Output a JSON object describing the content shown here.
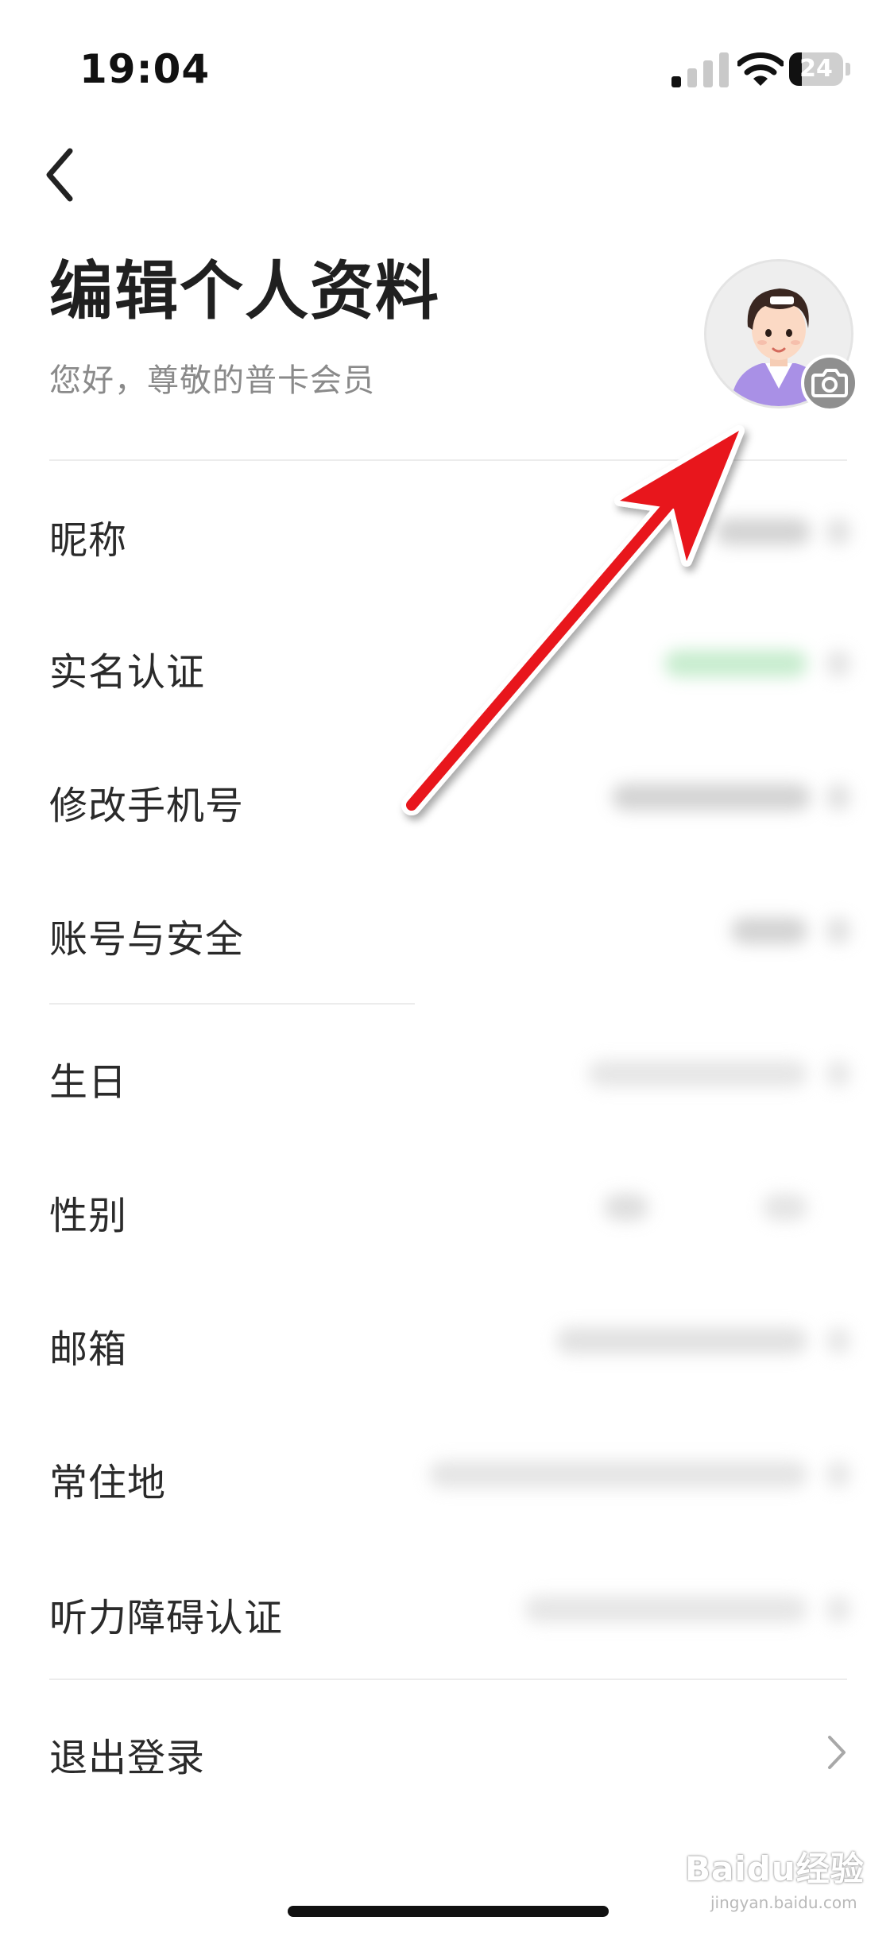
{
  "status_bar": {
    "time": "19:04",
    "battery": "24",
    "battery_level": 0.24
  },
  "header": {
    "title": "编辑个人资料",
    "subtitle": "您好，尊敬的普卡会员"
  },
  "icons": {
    "back": "chevron-left-icon",
    "avatar": "cartoon-avatar",
    "camera": "camera-icon",
    "chevron": "chevron-right-icon"
  },
  "rows": [
    {
      "label": "昵称"
    },
    {
      "label": "实名认证"
    },
    {
      "label": "修改手机号"
    },
    {
      "label": "账号与安全"
    },
    {
      "label": "生日"
    },
    {
      "label": "性别"
    },
    {
      "label": "邮箱"
    },
    {
      "label": "常住地"
    },
    {
      "label": "听力障碍认证"
    },
    {
      "label": "退出登录"
    }
  ],
  "watermark": {
    "logo": "Baidu经验",
    "sub": "jingyan.baidu.com"
  },
  "colors": {
    "annotation_arrow": "#e8141b",
    "verified_badge": "#5cc46e"
  }
}
